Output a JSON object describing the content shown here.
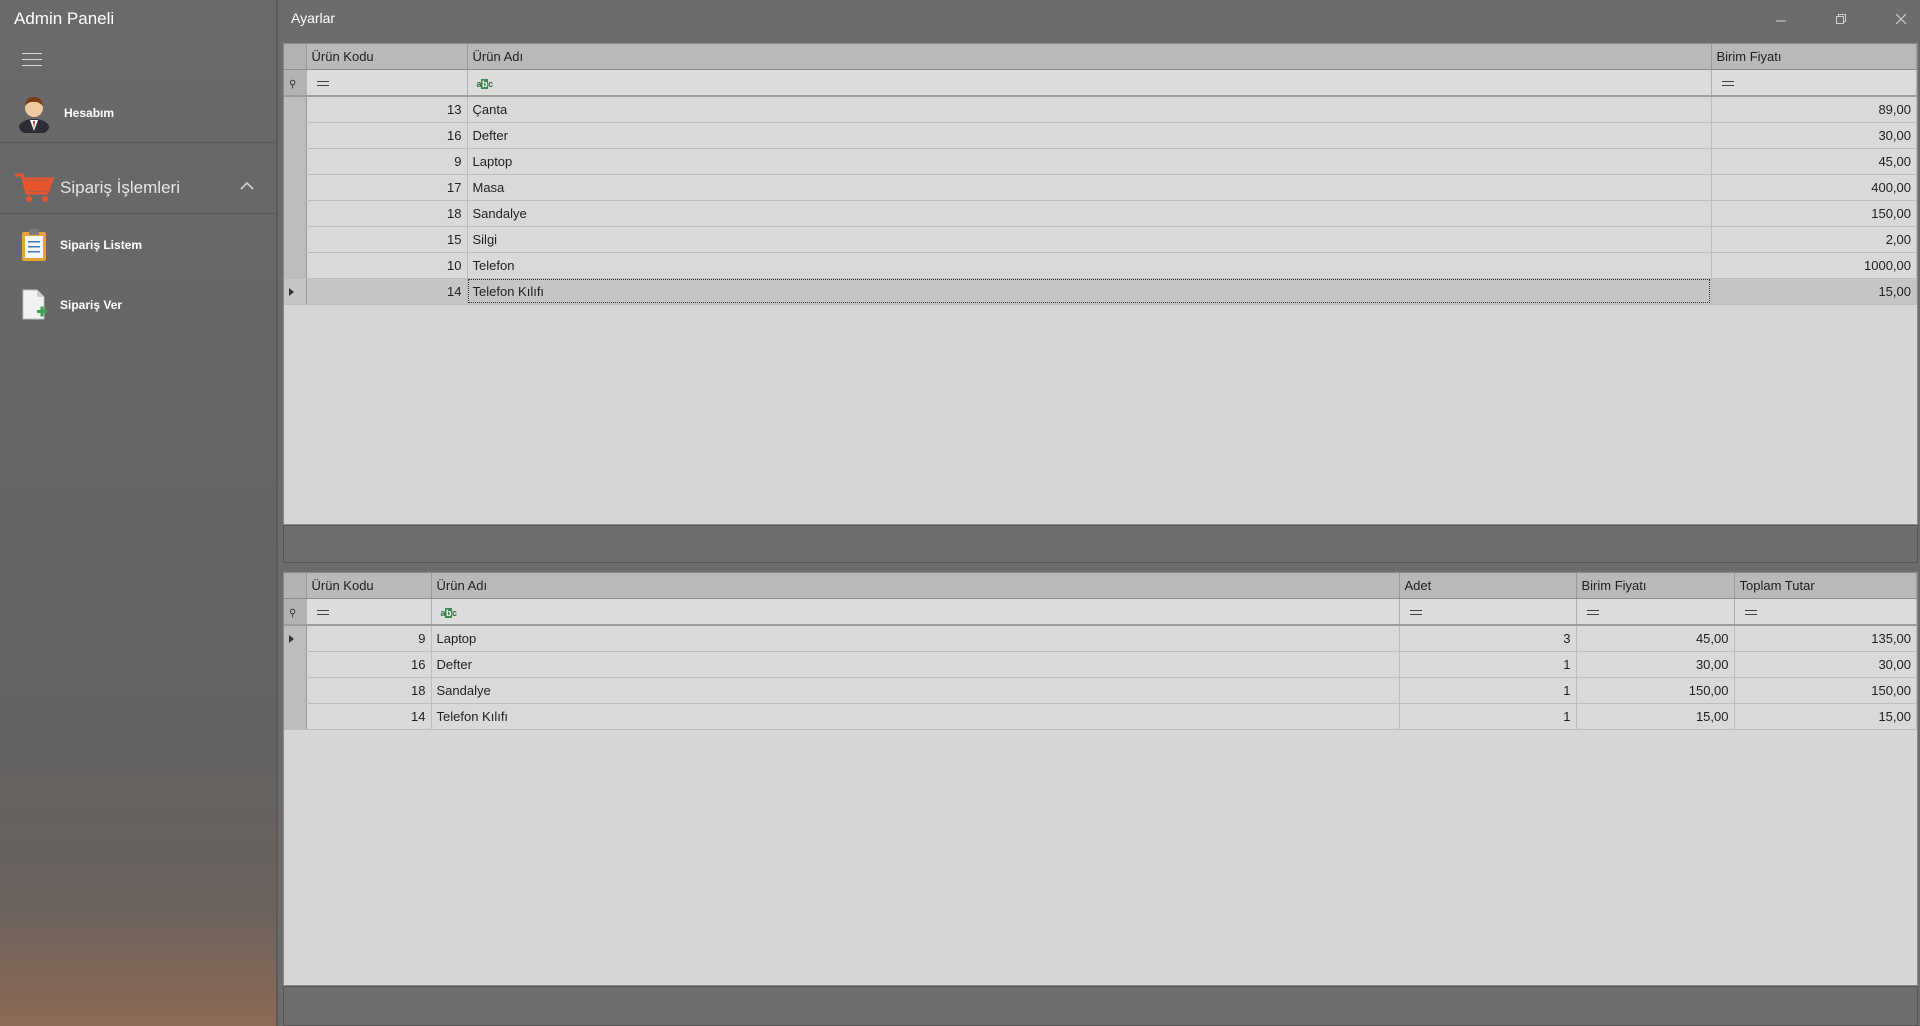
{
  "app": {
    "title": "Admin Paneli"
  },
  "sidebar": {
    "hesabim": "Hesabım",
    "group_label": "Sipariş İşlemleri",
    "items": [
      {
        "label": "Sipariş Listem"
      },
      {
        "label": "Sipariş Ver"
      }
    ]
  },
  "window": {
    "title": "Ayarlar"
  },
  "products": {
    "columns": [
      "Ürün Kodu",
      "Ürün Adı",
      "Birim Fiyatı"
    ],
    "rows": [
      {
        "kod": "13",
        "ad": "Çanta",
        "fiyat": "89,00"
      },
      {
        "kod": "16",
        "ad": "Defter",
        "fiyat": "30,00"
      },
      {
        "kod": "9",
        "ad": "Laptop",
        "fiyat": "45,00"
      },
      {
        "kod": "17",
        "ad": "Masa",
        "fiyat": "400,00"
      },
      {
        "kod": "18",
        "ad": "Sandalye",
        "fiyat": "150,00"
      },
      {
        "kod": "15",
        "ad": "Silgi",
        "fiyat": "2,00"
      },
      {
        "kod": "10",
        "ad": "Telefon",
        "fiyat": "1000,00"
      },
      {
        "kod": "14",
        "ad": "Telefon Kılıfı",
        "fiyat": "15,00"
      }
    ]
  },
  "cart": {
    "columns": [
      "Ürün Kodu",
      "Ürün Adı",
      "Adet",
      "Birim Fiyatı",
      "Toplam Tutar"
    ],
    "rows": [
      {
        "kod": "9",
        "ad": "Laptop",
        "adet": "3",
        "fiyat": "45,00",
        "toplam": "135,00"
      },
      {
        "kod": "16",
        "ad": "Defter",
        "adet": "1",
        "fiyat": "30,00",
        "toplam": "30,00"
      },
      {
        "kod": "18",
        "ad": "Sandalye",
        "adet": "1",
        "fiyat": "150,00",
        "toplam": "150,00"
      },
      {
        "kod": "14",
        "ad": "Telefon Kılıfı",
        "adet": "1",
        "fiyat": "15,00",
        "toplam": "15,00"
      }
    ]
  },
  "colors": {
    "accent_cart": "#e8542c"
  }
}
